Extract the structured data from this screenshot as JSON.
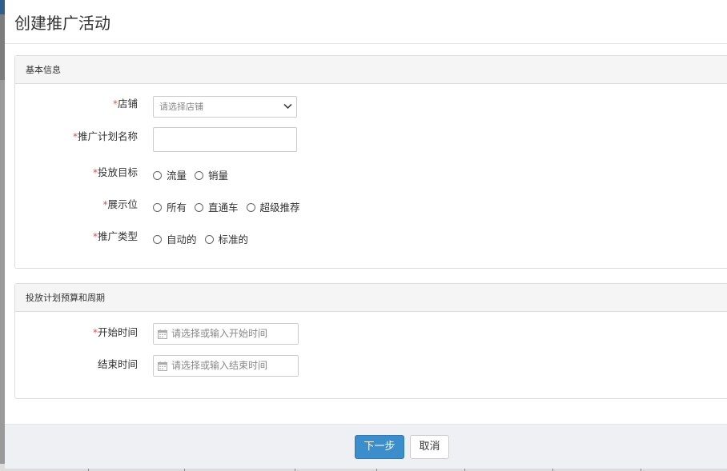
{
  "modal": {
    "title": "创建推广活动"
  },
  "basic_info": {
    "heading": "基本信息",
    "store": {
      "required_mark": "*",
      "label": "店铺",
      "placeholder": "请选择店铺"
    },
    "plan_name": {
      "required_mark": "*",
      "label": "推广计划名称",
      "value": ""
    },
    "goal": {
      "required_mark": "*",
      "label": "投放目标",
      "options": [
        "流量",
        "销量"
      ]
    },
    "placement": {
      "required_mark": "*",
      "label": "展示位",
      "options": [
        "所有",
        "直通车",
        "超级推荐"
      ]
    },
    "promo_type": {
      "required_mark": "*",
      "label": "推广类型",
      "options": [
        "自动的",
        "标准的"
      ]
    }
  },
  "budget_period": {
    "heading": "投放计划预算和周期",
    "start_time": {
      "required_mark": "*",
      "label": "开始时间",
      "placeholder": "请选择或输入开始时间"
    },
    "end_time": {
      "label": "结束时间",
      "placeholder": "请选择或输入结束时间"
    }
  },
  "footer": {
    "next_label": "下一步",
    "cancel_label": "取消"
  },
  "colors": {
    "primary": "#3c8dcc",
    "required": "#d9534f",
    "panel_heading_bg": "#f5f5f5",
    "footer_bg": "#eef0f3"
  }
}
